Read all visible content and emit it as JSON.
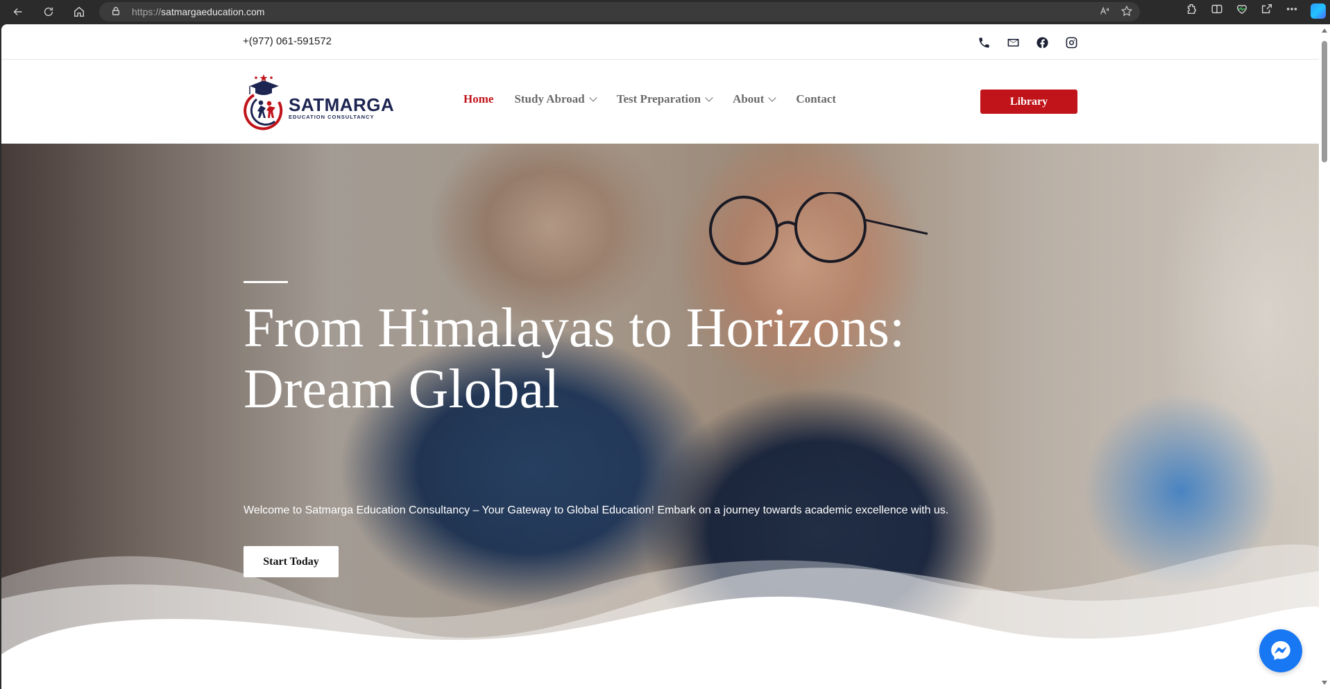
{
  "browser": {
    "url_protocol": "https://",
    "url_host": "satmargaeducation.com"
  },
  "topbar": {
    "phone": "+(977) 061-591572",
    "icons": [
      "phone-icon",
      "mail-icon",
      "facebook-icon",
      "instagram-icon"
    ]
  },
  "header": {
    "brand": "SATMARGA",
    "brand_sub": "EDUCATION CONSULTANCY",
    "nav": [
      {
        "label": "Home",
        "active": true
      },
      {
        "label": "Study Abroad",
        "has_dropdown": true
      },
      {
        "label": "Test Preparation",
        "has_dropdown": true
      },
      {
        "label": "About",
        "has_dropdown": true
      },
      {
        "label": "Contact"
      }
    ],
    "library_label": "Library"
  },
  "hero": {
    "title": "From Himalayas to Horizons: Dream Global",
    "lede": "Welcome to Satmarga Education Consultancy – Your Gateway to Global Education! Embark on a journey towards academic excellence with us.",
    "cta_label": "Start Today"
  },
  "colors": {
    "accent": "#c0141a",
    "brand_navy": "#1c2451",
    "messenger": "#1877f2"
  }
}
